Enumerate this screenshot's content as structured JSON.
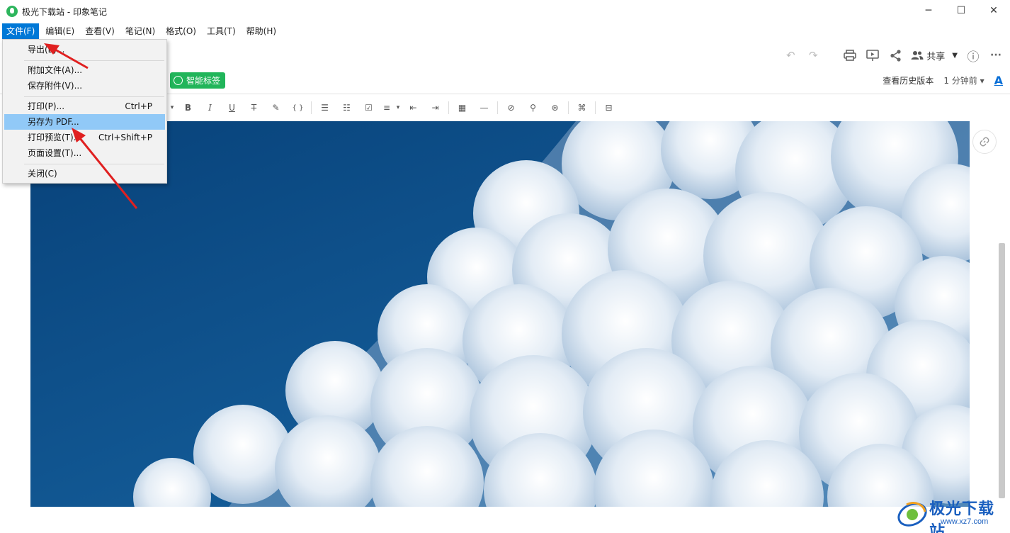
{
  "window": {
    "title": "极光下载站 - 印象笔记",
    "minimize": "─",
    "maximize": "☐",
    "close": "✕"
  },
  "menubar": {
    "items": [
      "文件(F)",
      "编辑(E)",
      "查看(V)",
      "笔记(N)",
      "格式(O)",
      "工具(T)",
      "帮助(H)"
    ]
  },
  "file_menu": {
    "items": [
      {
        "label": "导出(E)...",
        "shortcut": ""
      },
      {
        "label": "附加文件(A)...",
        "shortcut": ""
      },
      {
        "label": "保存附件(V)...",
        "shortcut": ""
      },
      {
        "label": "打印(P)...",
        "shortcut": "Ctrl+P"
      },
      {
        "label": "另存为 PDF...",
        "shortcut": ""
      },
      {
        "label": "打印预览(T)...",
        "shortcut": "Ctrl+Shift+P"
      },
      {
        "label": "页面设置(T)...",
        "shortcut": ""
      },
      {
        "label": "关闭(C)",
        "shortcut": ""
      }
    ],
    "highlighted": "另存为 PDF..."
  },
  "top_actions": {
    "share_label": "共享",
    "undo": "↶",
    "redo": "↷",
    "print": "⎙",
    "present": "▣",
    "share_icon": "⋰",
    "info": "ⓘ",
    "more": "···"
  },
  "tag_row": {
    "smart_tag_label": "智能标签",
    "history_label": "查看历史版本",
    "time_label": "1 分钟前 ▾",
    "font_icon": "A"
  },
  "format_toolbar": {
    "items": [
      "▾",
      "B",
      "I",
      "U",
      "T̶",
      "✎",
      "{ }",
      "☰",
      "☷",
      "☑",
      "≡",
      "▾",
      "⇤",
      "⇥",
      "▦",
      "—",
      "⊘",
      "⚲",
      "⊛",
      "⌘",
      "⊟"
    ]
  },
  "right_panel": {
    "link_icon": "🔗"
  },
  "watermark": {
    "text": "极光下载站",
    "url": "www.xz7.com"
  },
  "colors": {
    "menu_active": "#0078d7",
    "menu_highlight": "#91c9f7",
    "smart_tag": "#21b55a",
    "arrow": "#e02020",
    "sky": "#0d4f8b"
  }
}
